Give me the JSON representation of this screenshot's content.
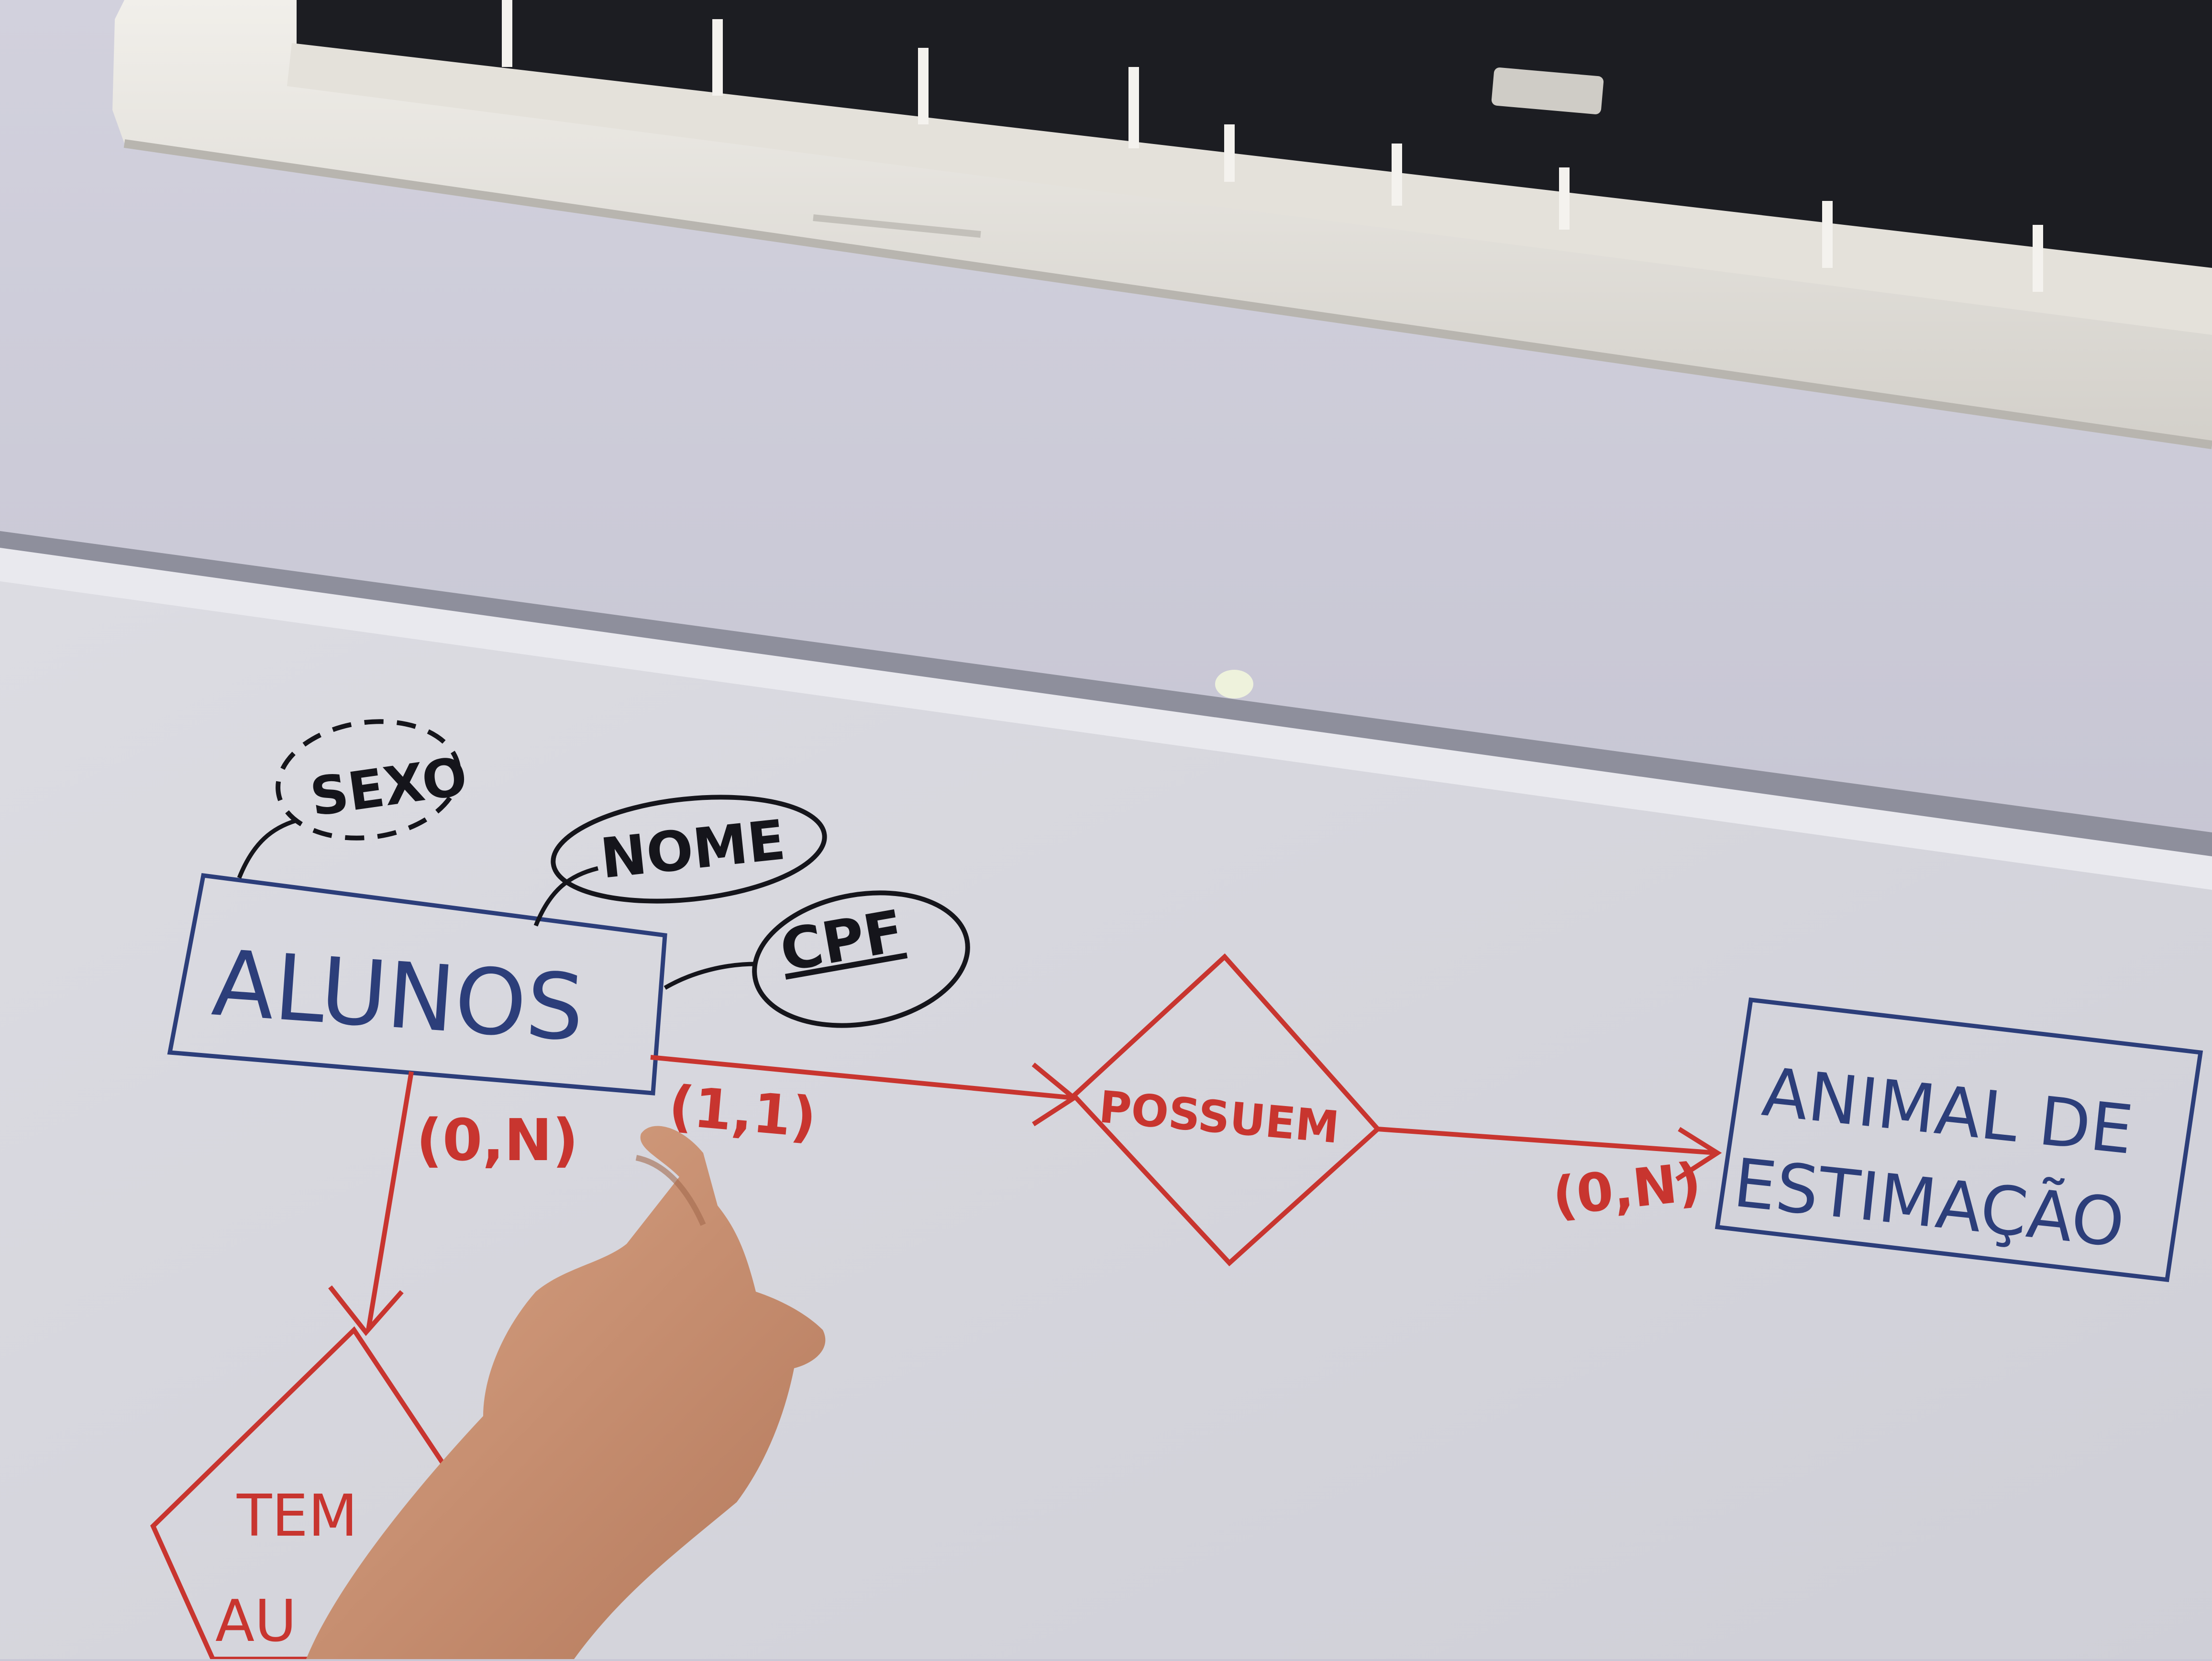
{
  "scene": {
    "description_type": "photo-of-whiteboard",
    "colors": {
      "wall": "#c9c8d6",
      "board": "#d8d8df",
      "board_frame": "#8e8f9c",
      "ac_unit": "#e6e4df",
      "ink_blue": "#2c3e7a",
      "ink_black": "#15151b",
      "ink_red": "#c8352f",
      "skin": "#c68d6f"
    },
    "icons": [
      "air-conditioner",
      "pointing-hand"
    ]
  },
  "diagram": {
    "entities": {
      "alunos": "ALUNOS",
      "animal_line1": "ANIMAL DE",
      "animal_line2": "ESTIMAÇÃO"
    },
    "attributes": {
      "sexo": "SEXO",
      "nome": "NOME",
      "cpf": "CPF"
    },
    "relationships": {
      "possuem": "POSSUEM",
      "tem_line1": "TEM",
      "tem_line2": "AU"
    },
    "cardinalities": {
      "alunos_tem": "(0,N)",
      "alunos_possuem": "(1,1)",
      "possuem_animal": "(0,N)"
    }
  }
}
